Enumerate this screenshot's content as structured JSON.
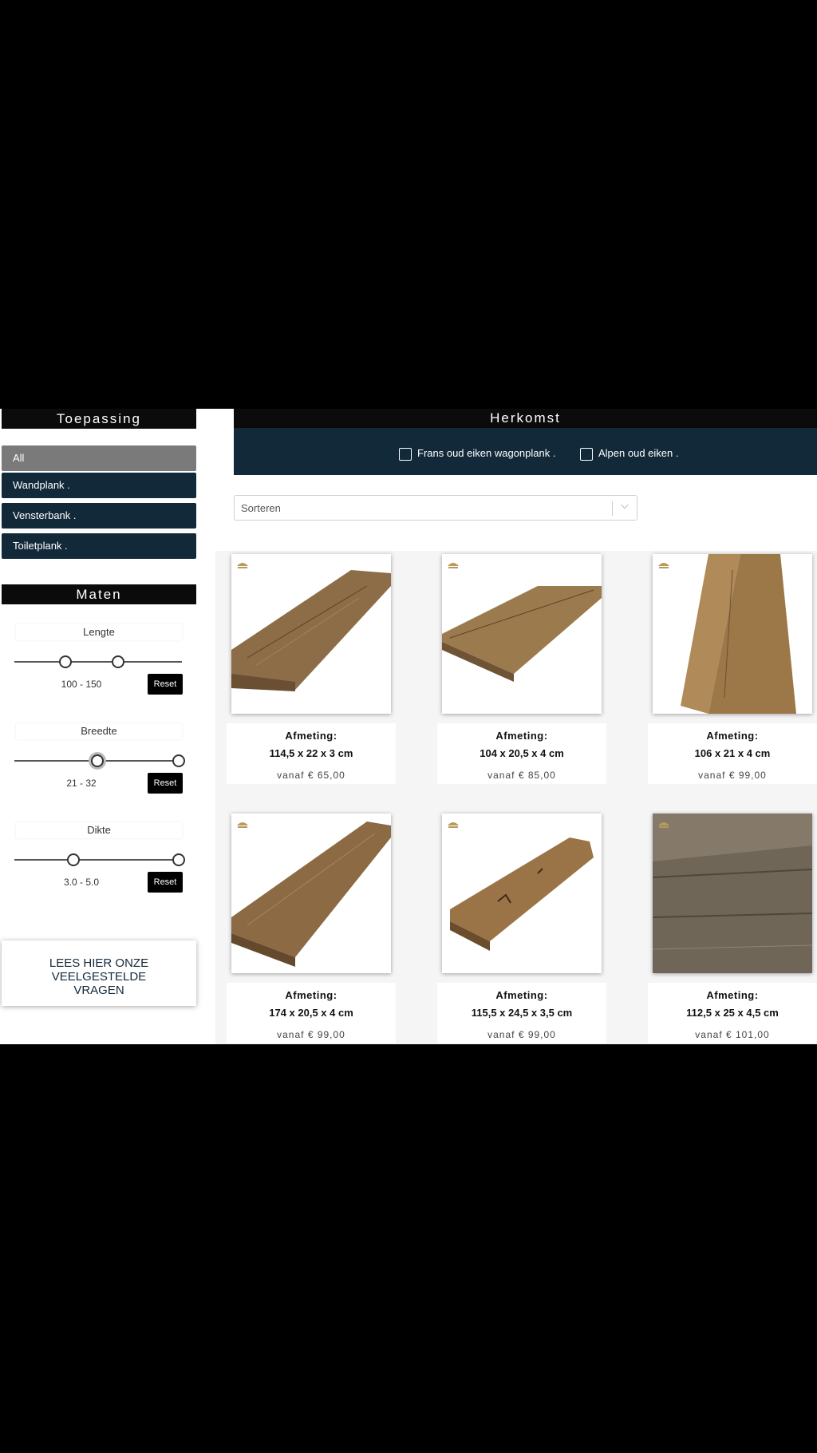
{
  "sidebar": {
    "toepassing": {
      "title": "Toepassing",
      "items": [
        {
          "label": "All",
          "active": true
        },
        {
          "label": "Wandplank .",
          "active": false
        },
        {
          "label": "Vensterbank .",
          "active": false
        },
        {
          "label": "Toiletplank .",
          "active": false
        }
      ]
    },
    "maten": {
      "title": "Maten",
      "lengte": {
        "label": "Lengte",
        "value": "100 - 150",
        "reset": "Reset"
      },
      "breedte": {
        "label": "Breedte",
        "value": "21 - 32",
        "reset": "Reset"
      },
      "dikte": {
        "label": "Dikte",
        "value": "3.0 - 5.0",
        "reset": "Reset"
      }
    },
    "faq_label": "LEES HIER ONZE\nVEELGESTELDE\nVRAGEN"
  },
  "herkomst": {
    "title": "Herkomst",
    "options": [
      {
        "label": "Frans oud eiken wagonplank .",
        "checked": false
      },
      {
        "label": "Alpen oud eiken .",
        "checked": false
      }
    ]
  },
  "sort": {
    "label": "Sorteren"
  },
  "products": [
    {
      "afmeting_label": "Afmeting:",
      "afmeting": "114,5 x 22 x 3 cm",
      "price": "vanaf € 65,00"
    },
    {
      "afmeting_label": "Afmeting:",
      "afmeting": "104 x 20,5 x 4 cm",
      "price": "vanaf € 85,00"
    },
    {
      "afmeting_label": "Afmeting:",
      "afmeting": "106 x 21 x 4 cm",
      "price": "vanaf € 99,00"
    },
    {
      "afmeting_label": "Afmeting:",
      "afmeting": "174 x 20,5 x 4 cm",
      "price": "vanaf € 99,00"
    },
    {
      "afmeting_label": "Afmeting:",
      "afmeting": "115,5 x 24,5 x 3,5 cm",
      "price": "vanaf € 99,00"
    },
    {
      "afmeting_label": "Afmeting:",
      "afmeting": "112,5 x 25 x 4,5 cm",
      "price": "vanaf € 101,00"
    }
  ],
  "colors": {
    "navy": "#12293a",
    "header": "#0b0b0b",
    "active": "#7a7a7a",
    "wood": "#8a6a45"
  },
  "icons": {
    "sort_chevron": "chevron-down-icon",
    "checkbox": "checkbox-icon"
  }
}
